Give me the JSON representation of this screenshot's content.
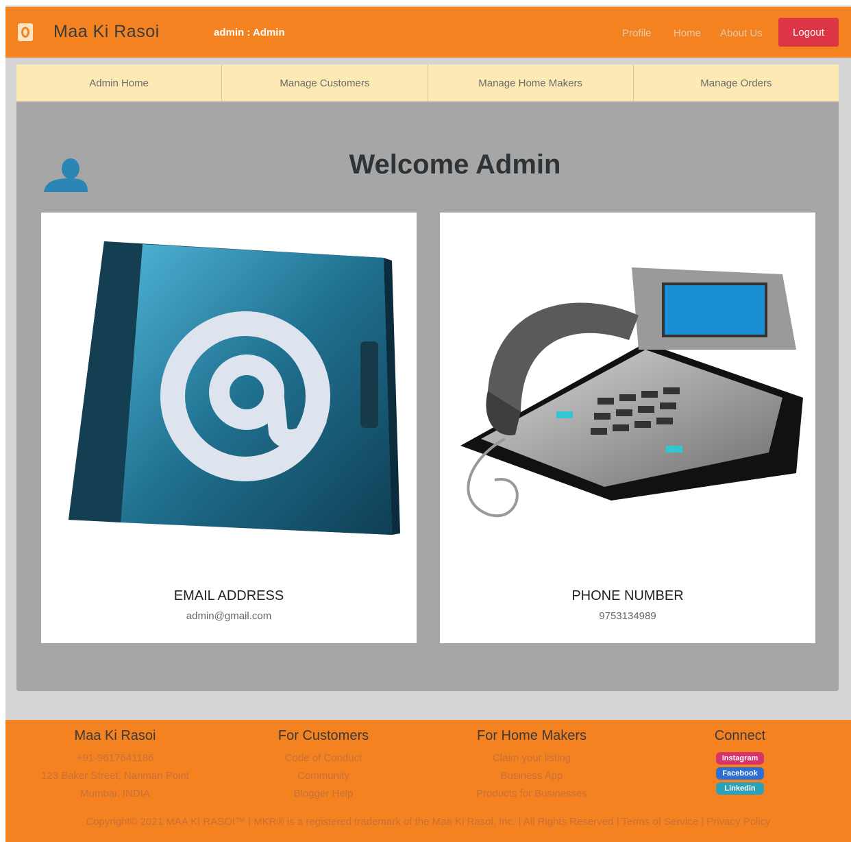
{
  "header": {
    "brand": "Maa Ki Rasoi",
    "user_label": "admin : Admin",
    "nav": [
      "Profile",
      "Home",
      "About Us"
    ],
    "logout": "Logout"
  },
  "subnav": [
    "Admin Home",
    "Manage Customers",
    "Manage Home Makers",
    "Manage Orders"
  ],
  "main": {
    "welcome": "Welcome Admin",
    "email_card": {
      "title": "EMAIL ADDRESS",
      "value": "admin@gmail.com"
    },
    "phone_card": {
      "title": "PHONE NUMBER",
      "value": "9753134989"
    }
  },
  "footer": {
    "col1": {
      "title": "Maa Ki Rasoi",
      "lines": [
        "+91-9617641186",
        "123 Baker Street, Nariman Point",
        "Mumbai, INDIA"
      ]
    },
    "col2": {
      "title": "For Customers",
      "lines": [
        "Code of Conduct",
        "Community",
        "Blogger Help"
      ]
    },
    "col3": {
      "title": "For Home Makers",
      "lines": [
        "Claim your listing",
        "Business App",
        "Products for Businesses"
      ]
    },
    "col4": {
      "title": "Connect",
      "social": [
        "Instagram",
        "Facebook",
        "Linkedin"
      ]
    },
    "copyright": "Copyright© 2021 MAA KI RASOI™ | MKR® is a registered trademark of the Maa Ki Rasoi, Inc. | All Rights Reserved | Terms of Service | Privacy Policy"
  },
  "colors": {
    "brand_orange": "#f58220",
    "logout_red": "#dc3545",
    "subnav_bg": "#fde9b3",
    "panel_gray": "#a6a6a6"
  },
  "icons": [
    "brand-logo-icon",
    "user-avatar-icon",
    "email-book-icon",
    "telephone-icon"
  ]
}
